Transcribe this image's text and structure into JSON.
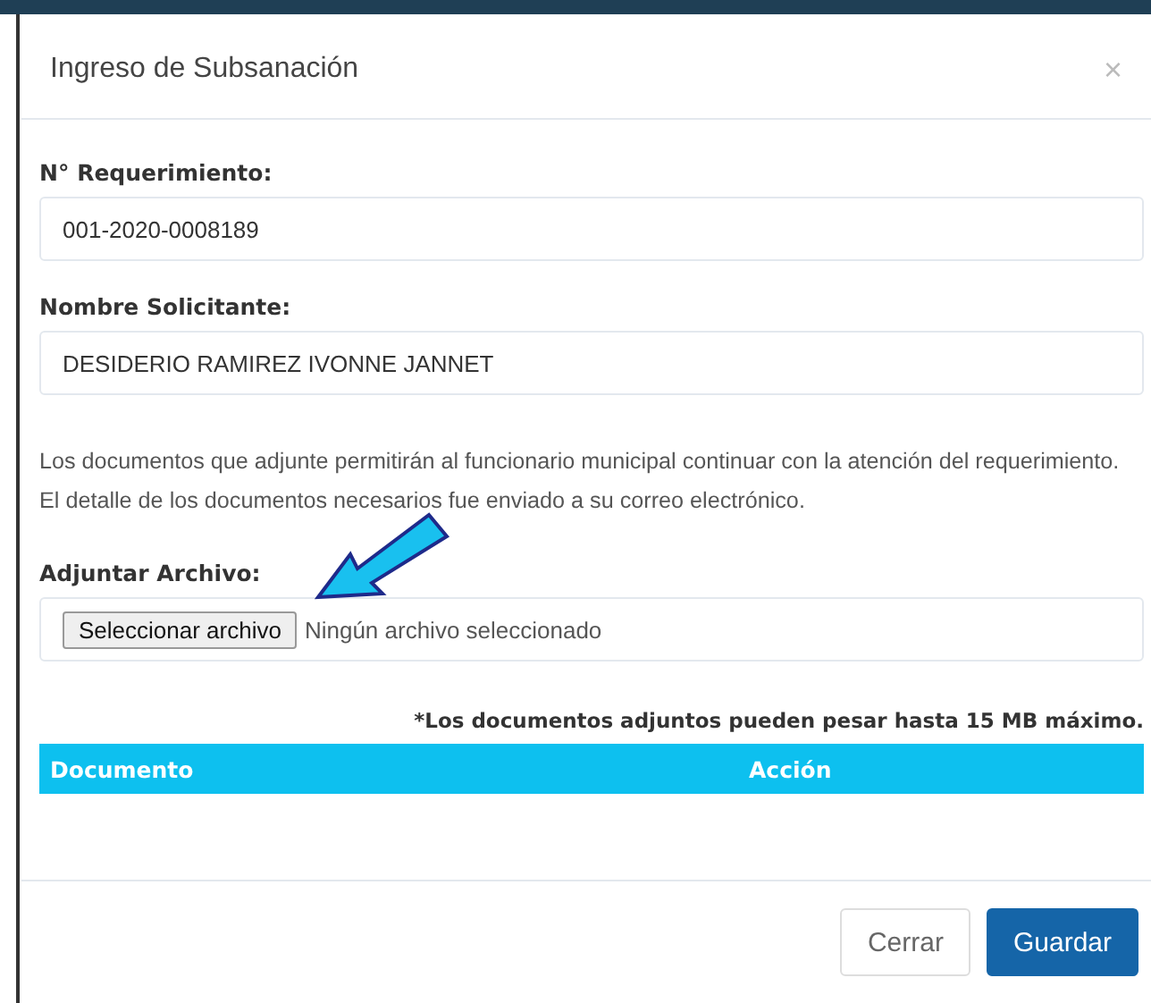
{
  "dialog": {
    "title": "Ingreso de Subsanación",
    "close": "×"
  },
  "fields": [
    {
      "label": "N° Requerimiento:",
      "value": "001-2020-0008189"
    },
    {
      "label": "Nombre Solicitante:",
      "value": "DESIDERIO RAMIREZ IVONNE JANNET"
    }
  ],
  "notice": "Los documentos que adjunte permitirán al funcionario municipal continuar con la atención del requerimiento. El detalle de los documentos necesarios fue enviado a su correo electrónico.",
  "attachment": {
    "label": "Adjuntar Archivo:",
    "button": "Seleccionar archivo",
    "status": "Ningún archivo seleccionado"
  },
  "size_note": "*Los documentos adjuntos pueden pesar hasta 15 MB máximo.",
  "table": {
    "columns": [
      "Documento",
      "Acción"
    ]
  },
  "buttons": [
    {
      "label": "Cerrar",
      "kind": "default"
    },
    {
      "label": "Guardar",
      "kind": "primary"
    }
  ]
}
